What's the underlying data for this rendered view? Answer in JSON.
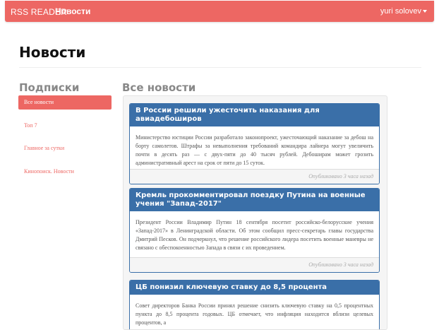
{
  "navbar": {
    "brand": "RSS READER",
    "active_link": "Новости",
    "user": "yuri solovev"
  },
  "page": {
    "title": "Новости"
  },
  "sidebar": {
    "title": "Подписки",
    "items": [
      {
        "label": "Все новости",
        "active": true
      },
      {
        "label": "Топ 7",
        "active": false
      },
      {
        "label": "Главное за сутки",
        "active": false
      },
      {
        "label": "Кинопоиск. Новости",
        "active": false
      }
    ]
  },
  "main": {
    "title": "Все новости",
    "articles": [
      {
        "title": "В России решили ужесточить наказания для авиадебоширов",
        "body": "Министерство юстиции России разработало законопроект, ужесточающий наказание за дебош на борту самолетов. Штрафы за невыполнения требований командира лайнера могут увеличить почти в десять раз — с двух-пяти до 40 тысяч рублей. Дебоширам может грозить административный арест на срок от пяти до 15 суток.",
        "published": "Опубликовано 3 часа назад"
      },
      {
        "title": "Кремль прокомментировал поездку Путина на военные учения \"Запад-2017\"",
        "body": "Президент России Владимир Путин 18 сентября посетит российско-белорусские учения «Запад-2017» в Ленинградской области. Об этом сообщил пресс-секретарь главы государства Дмитрий Песков. Он подчеркнул, что решение российского лидера посетить военные маневры не связано с обеспокоенностью Запада в связи с их проведением.",
        "published": "Опубликовано 3 часа назад"
      },
      {
        "title": "ЦБ понизил ключевую ставку до 8,5 процента",
        "body": "Совет директоров Банка России принял решение снизить ключевую ставку на 0,5 процентных пункта до 8,5 процента годовых. ЦБ отмечает, что инфляция находится вблизи целевых процентов, а"
      }
    ]
  }
}
